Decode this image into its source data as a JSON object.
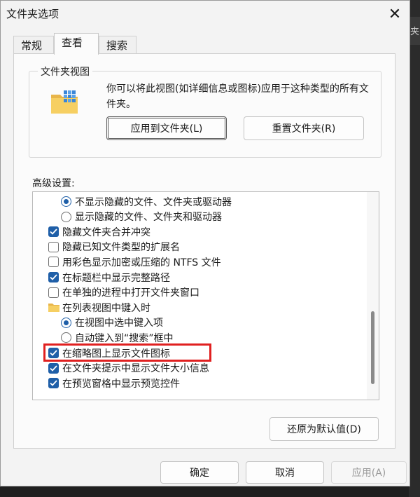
{
  "window": {
    "title": "文件夹选项",
    "close_glyph": "✕"
  },
  "behind_window": {
    "partial_text": "夹"
  },
  "tabs": [
    {
      "label": "常规",
      "active": false
    },
    {
      "label": "查看",
      "active": true
    },
    {
      "label": "搜索",
      "active": false
    }
  ],
  "folder_views": {
    "legend": "文件夹视图",
    "icon": "folder-views-icon",
    "description": "你可以将此视图(如详细信息或图标)应用于这种类型的所有文件夹。",
    "apply_button": "应用到文件夹(L)",
    "reset_button": "重置文件夹(R)"
  },
  "advanced": {
    "label": "高级设置:",
    "items": [
      {
        "type": "radio",
        "checked": true,
        "indent": 2,
        "label": "不显示隐藏的文件、文件夹或驱动器"
      },
      {
        "type": "radio",
        "checked": false,
        "indent": 2,
        "label": "显示隐藏的文件、文件夹和驱动器"
      },
      {
        "type": "checkbox",
        "checked": true,
        "indent": 1,
        "label": "隐藏文件夹合并冲突"
      },
      {
        "type": "checkbox",
        "checked": false,
        "indent": 1,
        "label": "隐藏已知文件类型的扩展名"
      },
      {
        "type": "checkbox",
        "checked": false,
        "indent": 1,
        "label": "用彩色显示加密或压缩的 NTFS 文件"
      },
      {
        "type": "checkbox",
        "checked": true,
        "indent": 1,
        "label": "在标题栏中显示完整路径"
      },
      {
        "type": "checkbox",
        "checked": false,
        "indent": 1,
        "label": "在单独的进程中打开文件夹窗口"
      },
      {
        "type": "folder",
        "checked": null,
        "indent": 1,
        "label": "在列表视图中键入时"
      },
      {
        "type": "radio",
        "checked": true,
        "indent": 2,
        "label": "在视图中选中键入项"
      },
      {
        "type": "radio",
        "checked": false,
        "indent": 2,
        "label": "自动键入到“搜索”框中"
      },
      {
        "type": "checkbox",
        "checked": true,
        "indent": 1,
        "label": "在缩略图上显示文件图标",
        "highlighted": true
      },
      {
        "type": "checkbox",
        "checked": true,
        "indent": 1,
        "label": "在文件夹提示中显示文件大小信息"
      },
      {
        "type": "checkbox",
        "checked": true,
        "indent": 1,
        "label": "在预览窗格中显示预览控件"
      }
    ],
    "restore_button": "还原为默认值(D)"
  },
  "footer": {
    "ok": "确定",
    "cancel": "取消",
    "apply": "应用(A)",
    "apply_enabled": false
  },
  "colors": {
    "accent": "#1f5fa8",
    "highlight": "#e02020"
  }
}
